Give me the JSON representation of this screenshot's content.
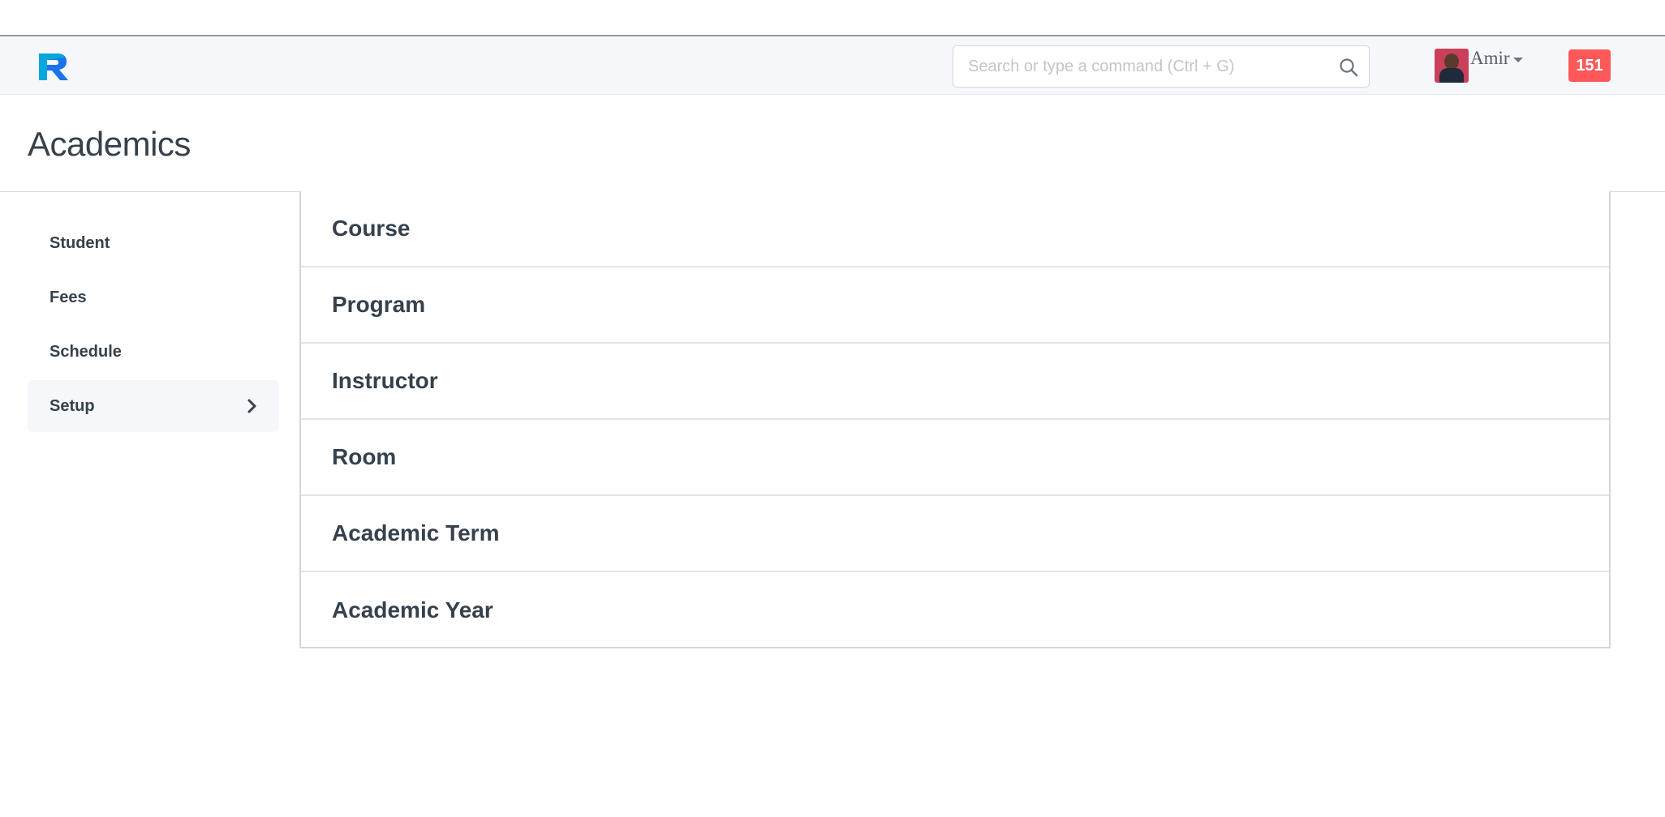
{
  "navbar": {
    "search": {
      "placeholder": "Search or type a command (Ctrl + G)",
      "value": ""
    },
    "user": {
      "name": "Amir"
    },
    "notifications": {
      "count": "151"
    },
    "colors": {
      "badge": "#ff5858",
      "logo_primary": "#1a73e8",
      "logo_secondary": "#00b0d9"
    }
  },
  "page": {
    "title": "Academics"
  },
  "sidebar": {
    "items": [
      {
        "label": "Student"
      },
      {
        "label": "Fees"
      },
      {
        "label": "Schedule"
      },
      {
        "label": "Setup",
        "active": true
      }
    ]
  },
  "setup": {
    "items": [
      {
        "label": "Course"
      },
      {
        "label": "Program"
      },
      {
        "label": "Instructor"
      },
      {
        "label": "Room"
      },
      {
        "label": "Academic Term"
      },
      {
        "label": "Academic Year"
      }
    ]
  }
}
